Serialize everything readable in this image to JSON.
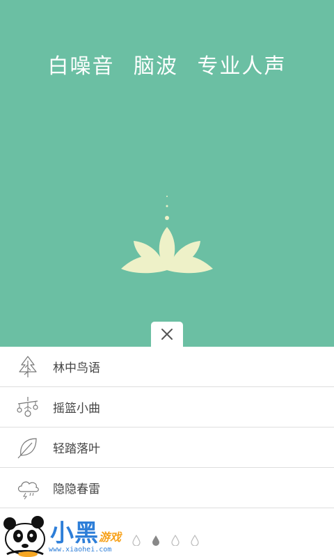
{
  "hero": {
    "tagline_parts": [
      "白噪音",
      "脑波",
      "专业人声"
    ],
    "background_color": "#6bbfa3",
    "lotus_color": "#eef1c8"
  },
  "close_button": {
    "icon": "close-icon"
  },
  "sound_list": [
    {
      "label": "林中鸟语",
      "icon": "tree-icon"
    },
    {
      "label": "摇篮小曲",
      "icon": "mobile-toy-icon"
    },
    {
      "label": "轻踏落叶",
      "icon": "leaf-icon"
    },
    {
      "label": "隐隐春雷",
      "icon": "thunder-cloud-icon"
    }
  ],
  "pager": {
    "total": 4,
    "active_index": 1
  },
  "watermark": {
    "brand": "小黑",
    "sub": "游戏",
    "url": "www.xiaohei.com"
  }
}
